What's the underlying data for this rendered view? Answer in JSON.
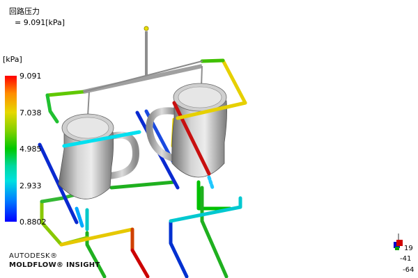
{
  "result": {
    "title": "回路压力",
    "value_text": "= 9.091[kPa]"
  },
  "legend": {
    "unit": "[kPa]",
    "ticks": [
      "9.091",
      "7.038",
      "4.985",
      "2.933",
      "0.8802"
    ],
    "max": 9.091,
    "min": 0.8802
  },
  "branding": {
    "line1": "AUTODESK®",
    "line2": "MOLDFLOW® INSIGHT"
  },
  "axis_triad": {
    "labels": [
      "19",
      "-41",
      "-64"
    ]
  },
  "colors": {
    "high": "#ff0000",
    "mid_high": "#e6d800",
    "mid": "#00c800",
    "mid_low": "#00e0e0",
    "low": "#0000ff",
    "part": "#a8a8a8"
  }
}
